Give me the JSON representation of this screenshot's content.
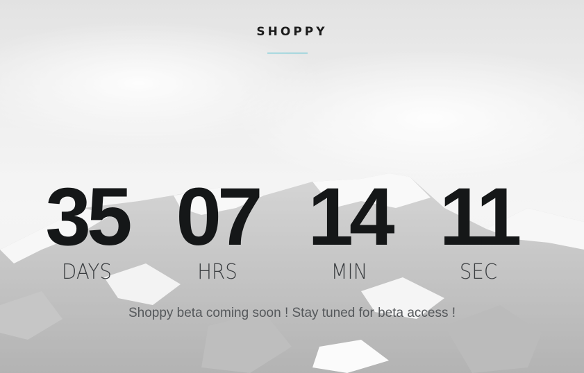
{
  "brand": {
    "name": "SHOPPY",
    "accent_color": "#29b6c9"
  },
  "countdown": {
    "days": {
      "value": "35",
      "label": "DAYS"
    },
    "hours": {
      "value": "07",
      "label": "HRS"
    },
    "minutes": {
      "value": "14",
      "label": "MIN"
    },
    "seconds": {
      "value": "11",
      "label": "SEC"
    }
  },
  "tagline": "Shoppy beta coming soon ! Stay tuned for beta access !",
  "background": {
    "image": "snowy-mountain-with-clouds"
  }
}
